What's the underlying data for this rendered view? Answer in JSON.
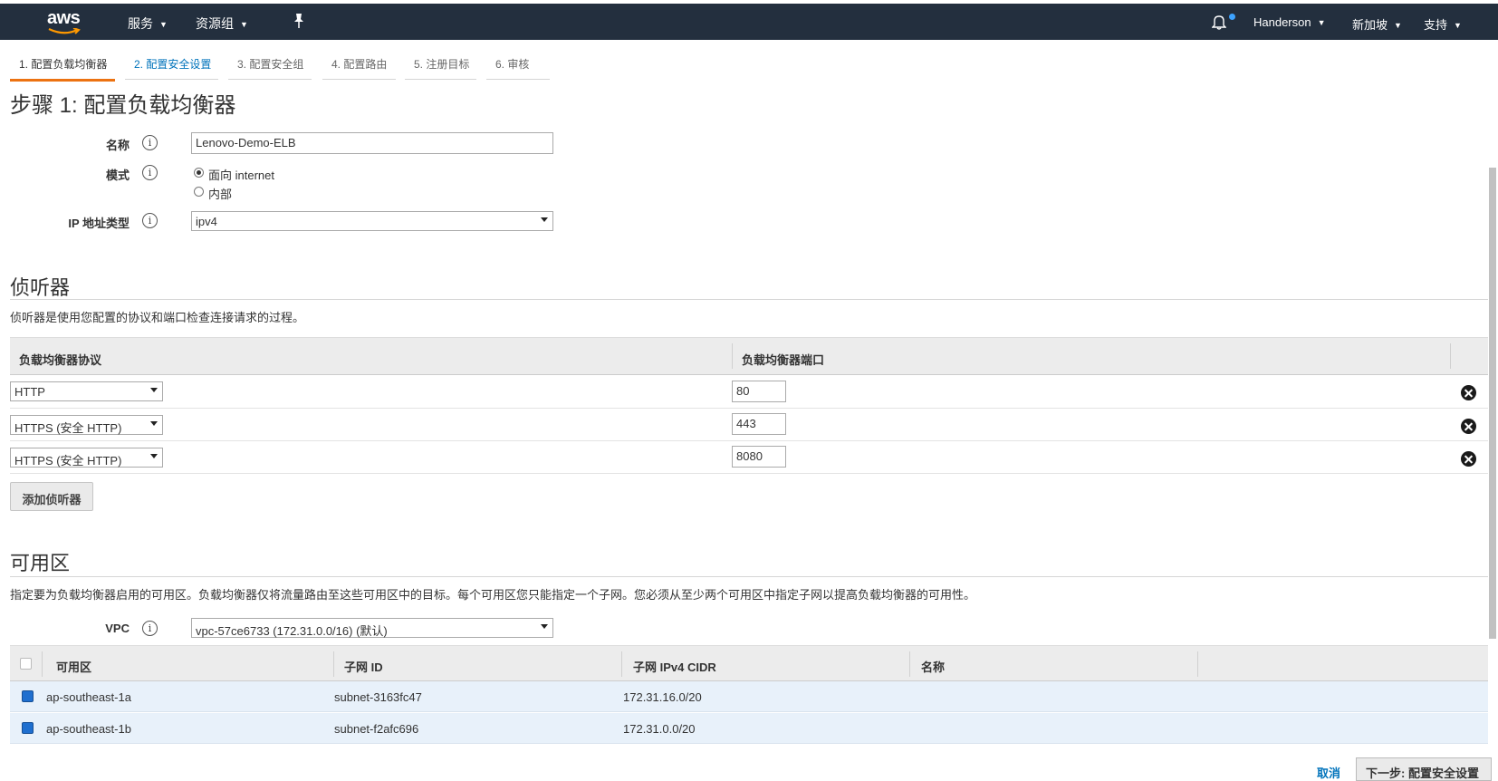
{
  "topnav": {
    "logo_text": "aws",
    "services_label": "服务",
    "resource_groups_label": "资源组",
    "user_label": "Handerson",
    "region_label": "新加坡",
    "support_label": "支持",
    "colors": {
      "bar": "#232f3e",
      "notification_dot": "#3da3ff",
      "logo_smile": "#ff9900"
    }
  },
  "wizard_tabs": [
    {
      "label": "1. 配置负载均衡器",
      "state": "active"
    },
    {
      "label": "2. 配置安全设置",
      "state": "link"
    },
    {
      "label": "3. 配置安全组",
      "state": "pending"
    },
    {
      "label": "4. 配置路由",
      "state": "pending"
    },
    {
      "label": "5. 注册目标",
      "state": "pending"
    },
    {
      "label": "6. 审核",
      "state": "pending"
    }
  ],
  "page_title": "步骤 1: 配置负载均衡器",
  "basic": {
    "name_label": "名称",
    "name_value": "Lenovo-Demo-ELB",
    "scheme_label": "模式",
    "scheme_options": [
      {
        "label": "面向 internet",
        "selected": true
      },
      {
        "label": "内部",
        "selected": false
      }
    ],
    "ip_type_label": "IP 地址类型",
    "ip_type_value": "ipv4"
  },
  "listeners": {
    "title": "侦听器",
    "description": "侦听器是使用您配置的协议和端口检查连接请求的过程。",
    "col_protocol": "负载均衡器协议",
    "col_port": "负载均衡器端口",
    "rows": [
      {
        "protocol": "HTTP",
        "port": "80"
      },
      {
        "protocol": "HTTPS (安全 HTTP)",
        "port": "443"
      },
      {
        "protocol": "HTTPS (安全 HTTP)",
        "port": "8080"
      }
    ],
    "add_button": "添加侦听器"
  },
  "availability_zones": {
    "title": "可用区",
    "description": "指定要为负载均衡器启用的可用区。负载均衡器仅将流量路由至这些可用区中的目标。每个可用区您只能指定一个子网。您必须从至少两个可用区中指定子网以提高负载均衡器的可用性。",
    "vpc_label": "VPC",
    "vpc_value": "vpc-57ce6733 (172.31.0.0/16) (默认)",
    "columns": [
      "可用区",
      "子网 ID",
      "子网 IPv4 CIDR",
      "名称"
    ],
    "rows": [
      {
        "checked": true,
        "zone": "ap-southeast-1a",
        "subnet_id": "subnet-3163fc47",
        "cidr": "172.31.16.0/20",
        "name": ""
      },
      {
        "checked": true,
        "zone": "ap-southeast-1b",
        "subnet_id": "subnet-f2afc696",
        "cidr": "172.31.0.0/20",
        "name": ""
      }
    ]
  },
  "footer": {
    "cancel_label": "取消",
    "next_label": "下一步: 配置安全设置"
  },
  "icons": {
    "notification": "bell-icon",
    "pin": "pin-icon",
    "info": "info-icon",
    "remove": "remove-circle-icon",
    "dropdown": "caret-down-icon"
  }
}
